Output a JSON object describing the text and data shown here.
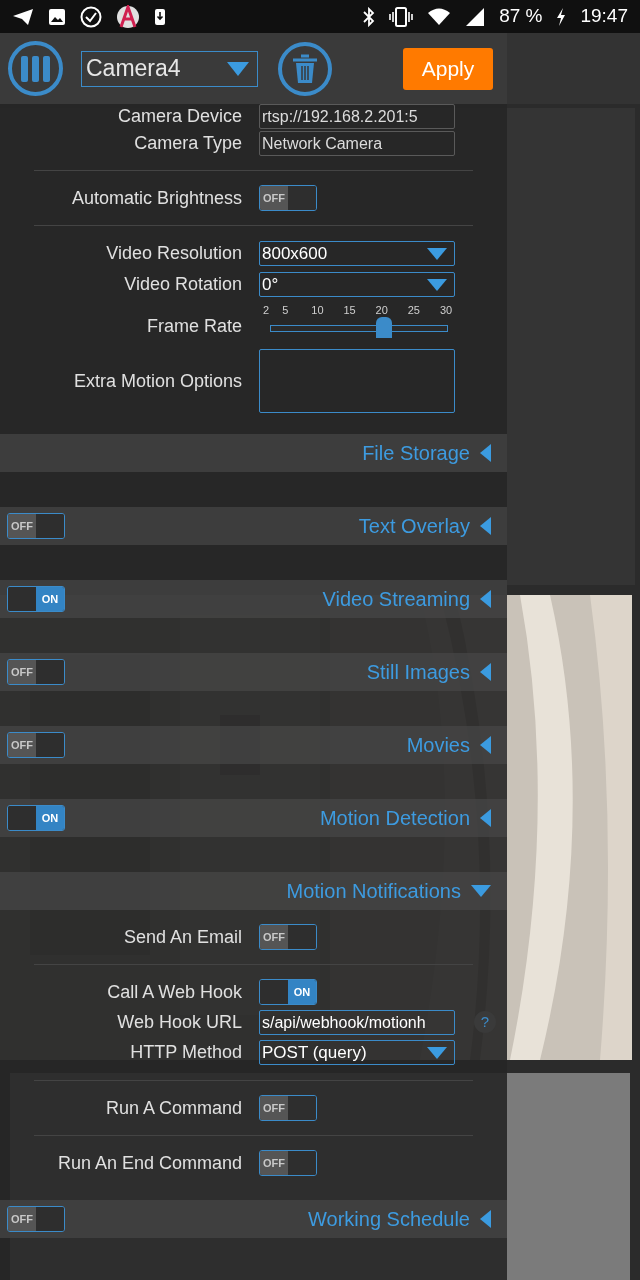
{
  "status_bar": {
    "battery": "87 %",
    "time": "19:47"
  },
  "toolbar": {
    "camera": "Camera4",
    "apply": "Apply"
  },
  "device_settings": [
    {
      "kind": "text",
      "label": "Camera Device",
      "value": "rtsp://192.168.2.201:5"
    },
    {
      "kind": "text",
      "label": "Camera Type",
      "value": "Network Camera"
    },
    {
      "kind": "divider"
    },
    {
      "kind": "toggle",
      "label": "Automatic Brightness",
      "toggle": {
        "on": false,
        "text": "OFF"
      }
    },
    {
      "kind": "divider"
    },
    {
      "kind": "select",
      "label": "Video Resolution",
      "value": "800x600"
    },
    {
      "kind": "select",
      "label": "Video Rotation",
      "value": "0°"
    },
    {
      "kind": "slider",
      "label": "Frame Rate",
      "ticks": [
        "2",
        "5",
        "10",
        "15",
        "20",
        "25",
        "30"
      ],
      "level": 0.643
    },
    {
      "kind": "textarea",
      "label": "Extra Motion Options"
    }
  ],
  "sections": [
    {
      "title": "File Storage",
      "expanded": false
    },
    {
      "title": "Text Overlay",
      "expanded": false,
      "toggle": {
        "on": false,
        "text": "OFF"
      }
    },
    {
      "title": "Video Streaming",
      "expanded": false,
      "toggle": {
        "on": true,
        "text": "ON"
      }
    },
    {
      "title": "Still Images",
      "expanded": false,
      "toggle": {
        "on": false,
        "text": "OFF"
      }
    },
    {
      "title": "Movies",
      "expanded": false,
      "toggle": {
        "on": false,
        "text": "OFF"
      }
    },
    {
      "title": "Motion Detection",
      "expanded": false,
      "toggle": {
        "on": true,
        "text": "ON"
      }
    },
    {
      "title": "Motion Notifications",
      "expanded": true,
      "rows": [
        {
          "kind": "toggle",
          "label": "Send An Email",
          "toggle": {
            "on": false,
            "text": "OFF"
          }
        },
        {
          "kind": "divider"
        },
        {
          "kind": "toggle",
          "label": "Call A Web Hook",
          "toggle": {
            "on": true,
            "text": "ON"
          }
        },
        {
          "kind": "text",
          "label": "Web Hook URL",
          "value": "s/api/webhook/motionh",
          "help": "?"
        },
        {
          "kind": "select",
          "label": "HTTP Method",
          "value": "POST (query)"
        },
        {
          "kind": "divider"
        },
        {
          "kind": "toggle",
          "label": "Run A Command",
          "toggle": {
            "on": false,
            "text": "OFF"
          }
        },
        {
          "kind": "divider"
        },
        {
          "kind": "toggle",
          "label": "Run An End Command",
          "toggle": {
            "on": false,
            "text": "OFF"
          }
        }
      ]
    },
    {
      "title": "Working Schedule",
      "expanded": false,
      "toggle": {
        "on": false,
        "text": "OFF"
      }
    }
  ]
}
